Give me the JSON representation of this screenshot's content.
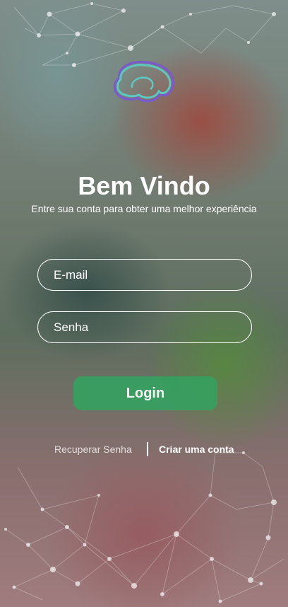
{
  "welcome": {
    "title": "Bem Vindo",
    "subtitle": "Entre sua conta para obter uma melhor experiência"
  },
  "form": {
    "email_placeholder": "E-mail",
    "password_placeholder": "Senha",
    "login_label": "Login"
  },
  "links": {
    "recover_label": "Recuperar Senha",
    "create_label": "Criar uma conta"
  },
  "colors": {
    "login_button": "#36a060",
    "logo_teal": "#5ec8c0",
    "logo_purple": "#7a5cc8"
  },
  "icons": {
    "logo": "brain-logo-icon"
  }
}
